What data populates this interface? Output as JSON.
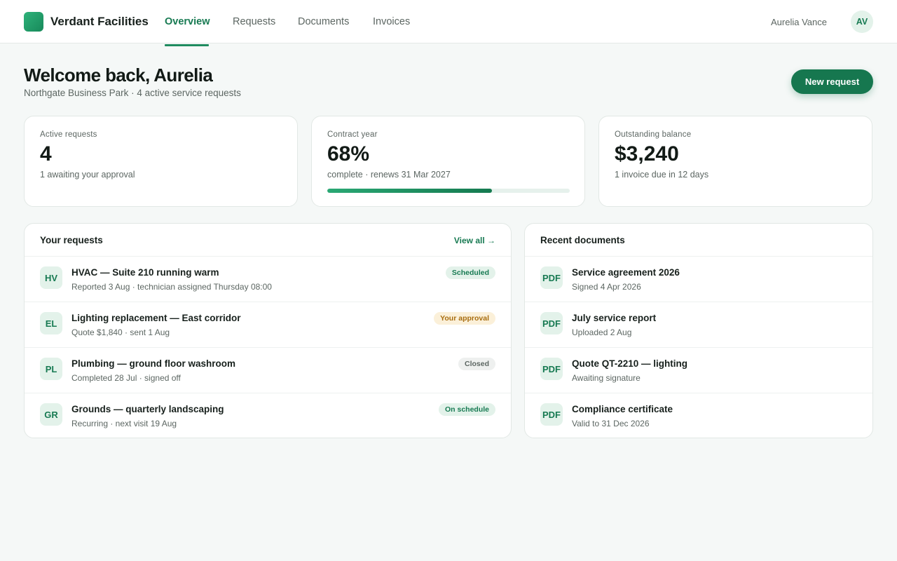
{
  "app": {
    "brand": "Verdant Facilities",
    "accent": "#16774f"
  },
  "nav": {
    "items": [
      {
        "label": "Overview",
        "active": true
      },
      {
        "label": "Requests",
        "active": false
      },
      {
        "label": "Documents",
        "active": false
      },
      {
        "label": "Invoices",
        "active": false
      }
    ]
  },
  "user": {
    "name": "Aurelia Vance",
    "initials": "AV"
  },
  "header": {
    "title": "Welcome back, Aurelia",
    "subtitle": "Northgate Business Park · 4 active service requests",
    "new_request_label": "New request"
  },
  "stats": [
    {
      "label": "Active requests",
      "value": "4",
      "sub": "1 awaiting your approval"
    },
    {
      "label": "Contract year",
      "value": "68%",
      "sub": "complete · renews 31 Mar 2027",
      "progress": 0.68
    },
    {
      "label": "Outstanding balance",
      "value": "$3,240",
      "sub": "1 invoice due in 12 days"
    }
  ],
  "requests": {
    "title": "Your requests",
    "view_all": "View all →",
    "items": [
      {
        "initials": "HV",
        "title": "HVAC — Suite 210 running warm",
        "sub": "Reported 3 Aug · technician assigned Thursday 08:00",
        "status": "Scheduled",
        "status_tone": "green"
      },
      {
        "initials": "EL",
        "title": "Lighting replacement — East corridor",
        "sub": "Quote $1,840 · sent 1 Aug",
        "status": "Your approval",
        "status_tone": "amber"
      },
      {
        "initials": "PL",
        "title": "Plumbing — ground floor washroom",
        "sub": "Completed 28 Jul · signed off",
        "status": "Closed",
        "status_tone": "gray"
      },
      {
        "initials": "GR",
        "title": "Grounds — quarterly landscaping",
        "sub": "Recurring · next visit 19 Aug",
        "status": "On schedule",
        "status_tone": "green"
      }
    ]
  },
  "documents": {
    "title": "Recent documents",
    "items": [
      {
        "icon": "PDF",
        "title": "Service agreement 2026",
        "sub": "Signed 4 Apr 2026"
      },
      {
        "icon": "PDF",
        "title": "July service report",
        "sub": "Uploaded 2 Aug"
      },
      {
        "icon": "PDF",
        "title": "Quote QT-2210 — lighting",
        "sub": "Awaiting signature"
      },
      {
        "icon": "PDF",
        "title": "Compliance certificate",
        "sub": "Valid to 31 Dec 2026"
      }
    ]
  }
}
